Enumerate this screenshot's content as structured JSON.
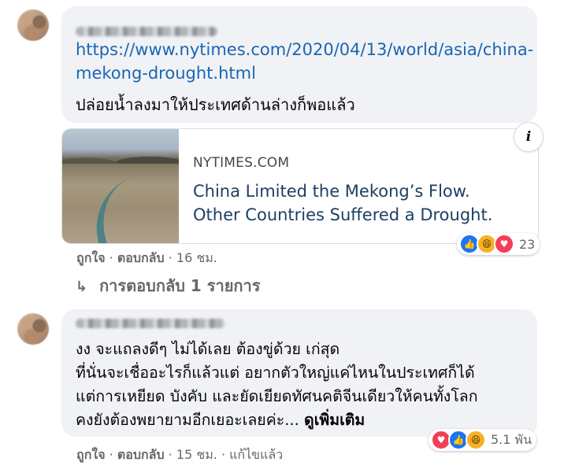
{
  "comment1": {
    "author_blurred": "Chavit Kitumongkol",
    "link": "https://www.nytimes.com/2020/04/13/world/asia/china-mekong-drought.html",
    "link_line1": "https://www.nytimes.com/2020/04/13/world/asia/china-",
    "link_line2": "mekong-drought.html",
    "text": "ปล่อยน้ำลงมาให้ประเทศด้านล่างก็พอแล้ว",
    "card": {
      "domain": "NYTIMES.COM",
      "title_line1": "China Limited the Mekong’s Flow.",
      "title_line2": "Other Countries Suffered a Drought."
    },
    "reactions": {
      "icons": [
        "like",
        "haha",
        "love"
      ],
      "count": "23"
    },
    "actions": {
      "like": "ถูกใจ",
      "reply": "ตอบกลับ",
      "time": "16 ชม."
    },
    "replies_label": "การตอบกลับ 1 รายการ"
  },
  "comment2": {
    "lines": [
      "งง จะแถลงดีๆ ไม่ได้เลย ต้องขู่ด้วย เก่สุด",
      "ที่นั่นจะเชื่ออะไรก็แล้วแต่ อยากตัวใหญ่แค่ไหนในประเทศก็ได้",
      "แต่การเหยียด บังคับ และยัดเยียดทัศนคติจีนเดียวให้คนทั้งโลก",
      "คงยังต้องพยายามอีกเยอะเลยค่ะ..."
    ],
    "see_more": "ดูเพิ่มเติม",
    "reactions": {
      "icons": [
        "love",
        "like",
        "haha"
      ],
      "count": "5.1 พัน"
    },
    "actions": {
      "like": "ถูกใจ",
      "reply": "ตอบกลับ",
      "time": "15 ชม.",
      "edited": "แก้ไขแล้ว"
    }
  },
  "colors": {
    "link": "#1a66b3",
    "like": "#1877f2",
    "love": "#f33e58",
    "haha": "#f7b125"
  }
}
